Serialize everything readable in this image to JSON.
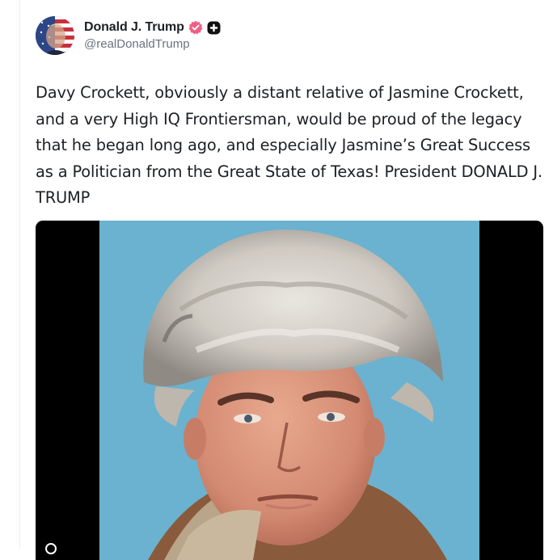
{
  "author": {
    "display_name": "Donald J. Trump",
    "handle": "@realDonaldTrump",
    "verified_icon": "verified-badge-icon",
    "extra_badge_icon": "plus-badge-icon",
    "avatar": "american-flag-portrait-avatar"
  },
  "post": {
    "text": "Davy Crockett, obviously a distant relative of Jasmine Crockett, and a very High IQ Frontiersman, would be proud of the legacy that he began long ago, and especially Jasmine’s Great Success as a Politician from the Great State of Texas! President DONALD J. TRUMP"
  },
  "media": {
    "type": "video",
    "subject": "man-in-coonskin-cap",
    "background_color": "#6ab2cf"
  },
  "colors": {
    "text": "#1c1f24",
    "muted": "#6b7280",
    "verified": "#f25f86",
    "badge": "#111111"
  }
}
